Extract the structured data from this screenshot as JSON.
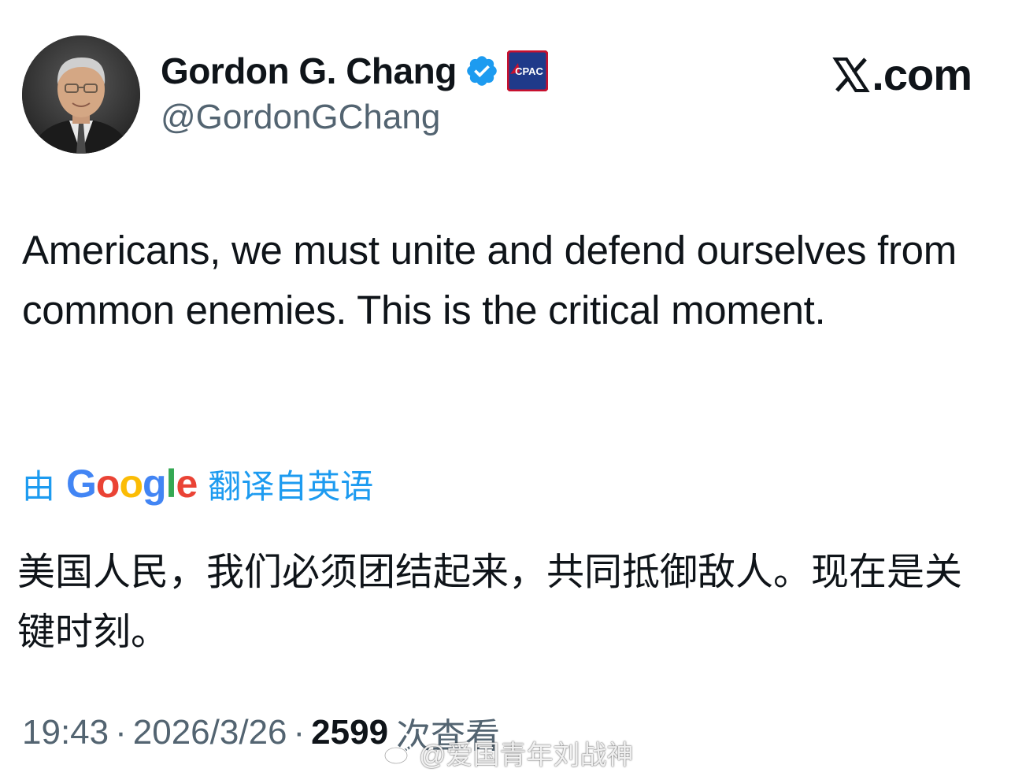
{
  "author": {
    "display_name": "Gordon G. Chang",
    "handle": "@GordonGChang",
    "verified_icon": "verified-check-icon",
    "affiliation_badge": {
      "icon": "cpac-badge-icon",
      "text": "CPAC"
    },
    "avatar": "avatar-photo"
  },
  "brand": {
    "text": ".com",
    "icon": "x-logo-icon"
  },
  "tweet": {
    "text": "Americans, we must unite and defend ourselves from common enemies. This is the critical moment."
  },
  "translation": {
    "prefix": "由",
    "provider": "Google",
    "suffix": "翻译自英语",
    "text": "美国人民，我们必须团结起来，共同抵御敌人。现在是关键时刻。"
  },
  "meta": {
    "time": "19:43",
    "date": "2026/3/26",
    "separator": "·",
    "views_count": "2599",
    "views_label": "次查看"
  },
  "watermark": {
    "text": "@爱国青年刘战神",
    "icon": "weibo-icon"
  },
  "colors": {
    "accent": "#1d9bf0",
    "secondary_text": "#536471",
    "primary_text": "#0f1419",
    "google_blue": "#4285f4",
    "google_red": "#ea4335",
    "google_yellow": "#fbbc05",
    "google_green": "#34a853"
  }
}
